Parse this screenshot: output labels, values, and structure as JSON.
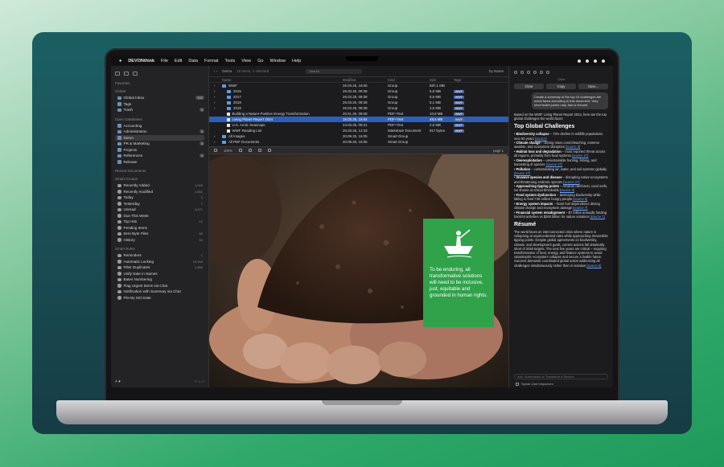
{
  "menubar": {
    "app": "DEVONthink",
    "items": [
      "File",
      "Edit",
      "Data",
      "Format",
      "Tools",
      "View",
      "Go",
      "Window",
      "Help"
    ]
  },
  "sidebar": {
    "sections": [
      {
        "title": "Favorites",
        "items": []
      },
      {
        "title": "Global",
        "items": [
          {
            "label": "Global Inbox",
            "count": "102"
          },
          {
            "label": "Tags",
            "count": ""
          },
          {
            "label": "Trash",
            "count": "5"
          }
        ]
      },
      {
        "title": "Open Databases",
        "items": [
          {
            "label": "Accounting",
            "count": ""
          },
          {
            "label": "Administration",
            "count": "3"
          },
          {
            "label": "Demo",
            "count": "",
            "selected": true
          },
          {
            "label": "PR & Marketing",
            "count": "3"
          },
          {
            "label": "Projects",
            "count": ""
          },
          {
            "label": "References",
            "count": "4"
          },
          {
            "label": "Release",
            "count": ""
          }
        ]
      },
      {
        "title": "Recent Documents",
        "items": []
      },
      {
        "title": "Smart Groups",
        "items": [
          {
            "label": "Recently Added",
            "count": "1,049"
          },
          {
            "label": "Recently modified",
            "count": "2,852"
          },
          {
            "label": "Today",
            "count": "3"
          },
          {
            "label": "Yesterday",
            "count": "7"
          },
          {
            "label": "Unread",
            "count": "3,471"
          },
          {
            "label": "Due This Week",
            "count": ""
          },
          {
            "label": "Top Hits",
            "count": "12"
          },
          {
            "label": "Pending Items",
            "count": ""
          },
          {
            "label": "Zero Byte Files",
            "count": "60"
          },
          {
            "label": "History",
            "count": "52"
          }
        ]
      },
      {
        "title": "Smart Rules",
        "items": [
          {
            "label": "Reminders",
            "count": "1"
          },
          {
            "label": "Automatic Locking",
            "count": "10,534"
          },
          {
            "label": "Filter Duplicates",
            "count": "1,855"
          },
          {
            "label": "Unify Date in Names",
            "count": ""
          },
          {
            "label": "Bates Numbering",
            "count": ""
          },
          {
            "label": "Flag Urgent Items via Chat",
            "count": ""
          },
          {
            "label": "Notification with Summary via Chat",
            "count": ""
          },
          {
            "label": "File By ISO Date",
            "count": ""
          }
        ]
      }
    ]
  },
  "list": {
    "toolbar_title": "Demo",
    "toolbar_sub": "15 items, 1 selected",
    "search_placeholder": "Search",
    "sort": "by Name",
    "columns": [
      "Name",
      "Modified",
      "Kind",
      "Size",
      "Tags"
    ],
    "rows": [
      {
        "name": "WWF",
        "modified": "26.03.25, 16:05",
        "kind": "Group",
        "size": "587,1 MB",
        "tag": "",
        "type": "folder",
        "indent": 0
      },
      {
        "name": "2015",
        "modified": "26.03.25, 09:38",
        "kind": "Group",
        "size": "5,6 MB",
        "tag": "WWF",
        "type": "folder",
        "indent": 1
      },
      {
        "name": "2017",
        "modified": "26.03.25, 09:38",
        "kind": "Group",
        "size": "5,6 MB",
        "tag": "WWF",
        "type": "folder",
        "indent": 1
      },
      {
        "name": "2018",
        "modified": "26.03.25, 09:38",
        "kind": "Group",
        "size": "5,1 MB",
        "tag": "WWF",
        "type": "folder",
        "indent": 1
      },
      {
        "name": "2019",
        "modified": "26.03.25, 09:38",
        "kind": "Group",
        "size": "4,5 MB",
        "tag": "WWF",
        "type": "folder",
        "indent": 1
      },
      {
        "name": "Building a Nature-Positive Energy Transformation",
        "modified": "20.01.25, 09:08",
        "kind": "PDF+Text",
        "size": "10,9 MB",
        "tag": "WWF",
        "type": "doc",
        "indent": 1
      },
      {
        "name": "Living Planet Report 2024",
        "modified": "18.03.25, 16:54",
        "kind": "PDF+Text",
        "size": "48,6 MB",
        "tag": "WWF",
        "type": "doc",
        "indent": 1,
        "selected": true
      },
      {
        "name": "U.S. Arctic Seascape",
        "modified": "24.03.25, 09:31",
        "kind": "PDF+Text",
        "size": "2,6 MB",
        "tag": "WWF",
        "type": "doc",
        "indent": 1
      },
      {
        "name": "WWF Reading List",
        "modified": "26.03.25, 12:33",
        "kind": "Markdown Document",
        "size": "917 bytes",
        "tag": "WWF",
        "type": "doc",
        "indent": 1
      },
      {
        "name": "All Images",
        "modified": "20.09.25, 16:05",
        "kind": "Smart Group",
        "size": "",
        "tag": "",
        "type": "folder",
        "indent": 0
      },
      {
        "name": "All PDF Documents",
        "modified": "20.09.25, 16:05",
        "kind": "Smart Group",
        "size": "",
        "tag": "",
        "type": "folder",
        "indent": 0
      }
    ]
  },
  "viewer": {
    "zoom": "100%",
    "page": "page 1",
    "card_text": "To be enduring, all transformative solutions will need to be inclusive, just, equitable and grounded in human rights."
  },
  "chat": {
    "title": "Chat",
    "buttons": [
      "Clear",
      "Copy",
      "Save..."
    ],
    "prompt": "Create a summary of the top 10 challenges the world faces according to this document. Very short bullet points only. Add a résumé.",
    "intro": "Based on the WWF Living Planet Report 2024, here are the top global challenges the world faces:",
    "heading": "Top Global Challenges",
    "challenges": [
      {
        "title": "Biodiversity collapse",
        "text": " – 73% decline in wildlife populations over 50 years",
        "src": "[source]"
      },
      {
        "title": "Climate change",
        "text": " – driving mass coral bleaching, extreme weather, and ecosystem disruption",
        "src": "[source 3]"
      },
      {
        "title": "Habitat loss and degradation",
        "text": " – most reported threat across all regions, primarily from food systems",
        "src": "[source 27]"
      },
      {
        "title": "Overexploitation",
        "text": " – unsustainable hunting, fishing, and harvesting of species",
        "src": "[source 27]"
      },
      {
        "title": "Pollution",
        "text": " – contaminating air, water, and soil systems globally",
        "src": "[source 27]"
      },
      {
        "title": "Invasive species and disease",
        "text": " – disrupting native ecosystems and threatening endemic species",
        "src": "[source 27]"
      },
      {
        "title": "Approaching tipping points",
        "text": " – Amazon rainforest, coral reefs, ice sheets at critical thresholds",
        "src": "[source 3]"
      },
      {
        "title": "Food system dysfunction",
        "text": " – destroying biodiversity while failing to feed 735 million hungry people",
        "src": "[source 6]"
      },
      {
        "title": "Energy system impacts",
        "text": " – fossil fuel dependence driving climate change and ecosystem damage",
        "src": "[source 7]"
      },
      {
        "title": "Financial system misalignment",
        "text": " – $7 trillion annually funding harmful activities vs $200 billion for nature solutions",
        "src": "[source 7]"
      }
    ],
    "resume_heading": "Résumé",
    "resume": "The world faces an interconnected crisis where nature is collapsing at unprecedented rates while approaching irreversible tipping points. Despite global agreements on biodiversity, climate, and development goals, current actions fall drastically short of 2030 targets. The next five years are critical – requiring transformation of food, energy, and finance systems to avoid catastrophic ecosystem collapse and secure a livable future. Success demands coordinated global action addressing all challenges simultaneously rather than in isolation",
    "resume_src": "[source 8]",
    "input_placeholder": "Ask, Summarize or Transform a Section",
    "checkbox_label": "Speak chat responses"
  }
}
